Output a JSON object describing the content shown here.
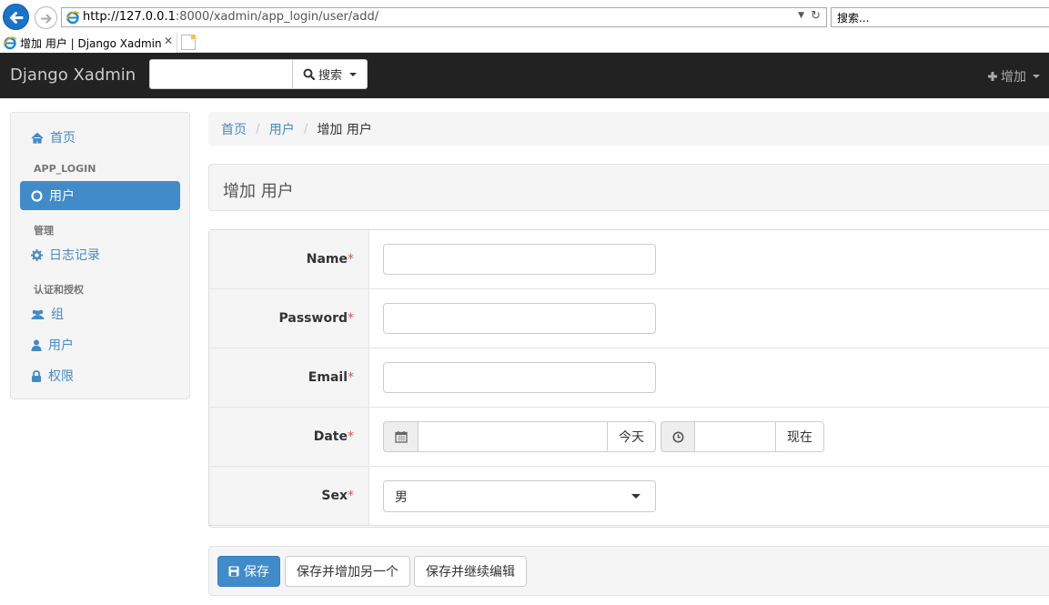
{
  "browser": {
    "url_host": "http://127.0.0.1",
    "url_rest": ":8000/xadmin/app_login/user/add/",
    "search_placeholder": "搜索...",
    "tab_title": "增加 用户 | Django Xadmin"
  },
  "navbar": {
    "brand": "Django Xadmin",
    "search_button": "搜索",
    "add_label": "增加"
  },
  "sidebar": {
    "home": "首页",
    "section_app": "APP_LOGIN",
    "app_user": "用户",
    "section_manage": "管理",
    "logs": "日志记录",
    "section_auth": "认证和授权",
    "groups": "组",
    "users": "用户",
    "permissions": "权限"
  },
  "breadcrumb": {
    "home": "首页",
    "section": "用户",
    "current": "增加 用户"
  },
  "page": {
    "title": "增加 用户"
  },
  "form": {
    "required_mark": "*",
    "fields": [
      {
        "label": "Name",
        "value": ""
      },
      {
        "label": "Password",
        "value": ""
      },
      {
        "label": "Email",
        "value": ""
      },
      {
        "label": "Date",
        "value": ""
      },
      {
        "label": "Sex",
        "value": "男"
      }
    ],
    "today_button": "今天",
    "now_button": "现在",
    "time_value": ""
  },
  "actions": {
    "save": "保存",
    "save_add_another": "保存并增加另一个",
    "save_continue": "保存并继续编辑"
  },
  "colors": {
    "primary": "#428bca",
    "navbar": "#222222",
    "required": "#d9534f"
  }
}
